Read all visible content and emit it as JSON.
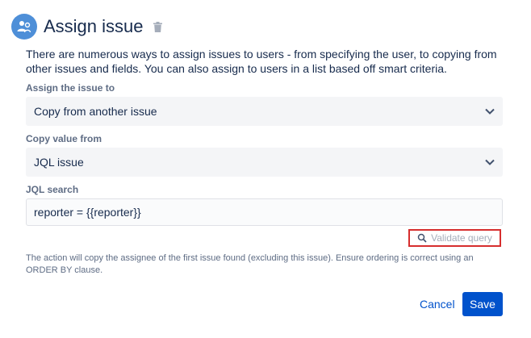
{
  "header": {
    "title": "Assign issue",
    "avatar_icon": "assign-user-icon",
    "delete_icon": "trash-icon"
  },
  "description": "There are numerous ways to assign issues to users - from specifying the user, to copying from other issues and fields. You can also assign to users in a list based off smart criteria.",
  "assign_to": {
    "label": "Assign the issue to",
    "value": "Copy from another issue"
  },
  "copy_from": {
    "label": "Copy value from",
    "value": "JQL issue"
  },
  "jql_search": {
    "label": "JQL search",
    "value": "reporter = {{reporter}}"
  },
  "validate": {
    "label": "Validate query",
    "icon": "search-icon"
  },
  "help_text": "The action will copy the assignee of the first issue found (excluding this issue). Ensure ordering is correct using an ORDER BY clause.",
  "actions": {
    "cancel_label": "Cancel",
    "save_label": "Save"
  },
  "colors": {
    "primary": "#0052cc",
    "avatar": "#4e8fd8",
    "highlight_box": "#d62e2e"
  }
}
